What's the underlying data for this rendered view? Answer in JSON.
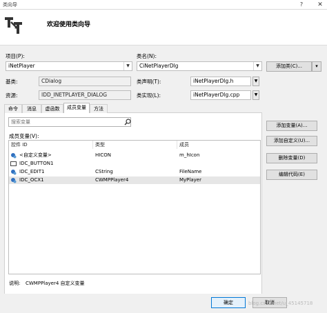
{
  "window": {
    "title": "类向导",
    "help_glyph": "?",
    "close_glyph": "✕"
  },
  "header": {
    "title": "欢迎使用类向导"
  },
  "project": {
    "label": "项目(P):",
    "value": "iNetPlayer"
  },
  "classname": {
    "label": "类名(N):",
    "value": "CiNetPlayerDlg"
  },
  "add_class_button": {
    "label": "添加类(C)...",
    "dropdown_glyph": "▾"
  },
  "baseclass": {
    "label": "基类:",
    "value": "CDialog"
  },
  "class_decl": {
    "label": "类声明(T):",
    "value": "iNetPlayerDlg.h"
  },
  "resource": {
    "label": "资源:",
    "value": "IDD_INETPLAYER_DIALOG"
  },
  "class_impl": {
    "label": "类实现(L):",
    "value": "iNetPlayerDlg.cpp"
  },
  "tabs": [
    "命令",
    "消息",
    "虚函数",
    "成员变量",
    "方法"
  ],
  "active_tab": 3,
  "search": {
    "placeholder": "搜索变量"
  },
  "members_label": "成员变量(V):",
  "columns": [
    "控件 ID",
    "类型",
    "成员"
  ],
  "rows": [
    {
      "id": "<自定义变量>",
      "type": "HICON",
      "member": "m_hIcon",
      "icon": "custom-variable-icon"
    },
    {
      "id": "IDC_BUTTON1",
      "type": "",
      "member": "",
      "icon": "button-control-icon"
    },
    {
      "id": "IDC_EDIT1",
      "type": "CString",
      "member": "FileName",
      "icon": "variable-icon"
    },
    {
      "id": "IDC_OCX1",
      "type": "CWMPPlayer4",
      "member": "MyPlayer",
      "icon": "variable-icon"
    }
  ],
  "selected_row": 3,
  "side_buttons": {
    "add_variable": "添加变量(A)...",
    "add_custom": "添加自定义(U)...",
    "delete_variable": "删除变量(D)",
    "edit_code": "编辑代码(E)"
  },
  "description": {
    "label": "说明:",
    "value": "CWMPPlayer4 自定义变量"
  },
  "footer": {
    "ok": "确定",
    "cancel": "取消"
  },
  "watermark": "blog.csdn.net/u_45145718"
}
